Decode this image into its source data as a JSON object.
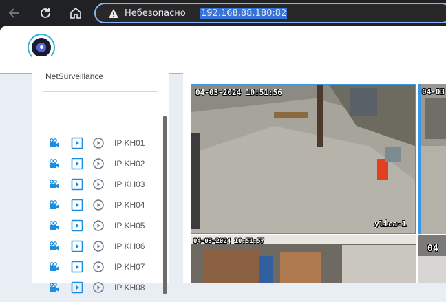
{
  "browser": {
    "security_label": "Небезопасно",
    "url": "192.168.88.180:82"
  },
  "sidebar": {
    "title": "NetSurveillance",
    "channels": [
      {
        "label": "IP KH01"
      },
      {
        "label": "IP KH02"
      },
      {
        "label": "IP KH03"
      },
      {
        "label": "IP KH04"
      },
      {
        "label": "IP KH05"
      },
      {
        "label": "IP KH06"
      },
      {
        "label": "IP KH07"
      },
      {
        "label": "IP KH08"
      }
    ]
  },
  "videos": [
    {
      "timestamp": "04-03-2024 10:51:56",
      "name": "ylica-1"
    },
    {
      "timestamp": "04-03"
    },
    {
      "timestamp": "04-03-2024 10:51:57"
    },
    {
      "timestamp": "04"
    }
  ],
  "colors": {
    "accent": "#1a8ee0",
    "selected_border": "#3a97e0",
    "header_border": "#7ec3d6"
  }
}
